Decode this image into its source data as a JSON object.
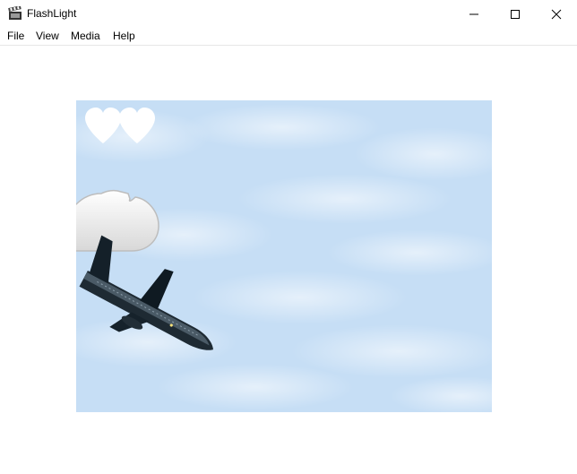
{
  "window": {
    "title": "FlashLight",
    "icon": "clapperboard-icon",
    "controls": [
      "minimize-icon",
      "maximize-icon",
      "close-icon"
    ]
  },
  "menu": {
    "file": "File",
    "view": "View",
    "media": "Media",
    "help": "Help"
  },
  "game": {
    "lives": 2,
    "sky_color": "#c8e0f6",
    "icons": [
      "heart-icon",
      "cloud-icon",
      "airplane-icon"
    ]
  }
}
